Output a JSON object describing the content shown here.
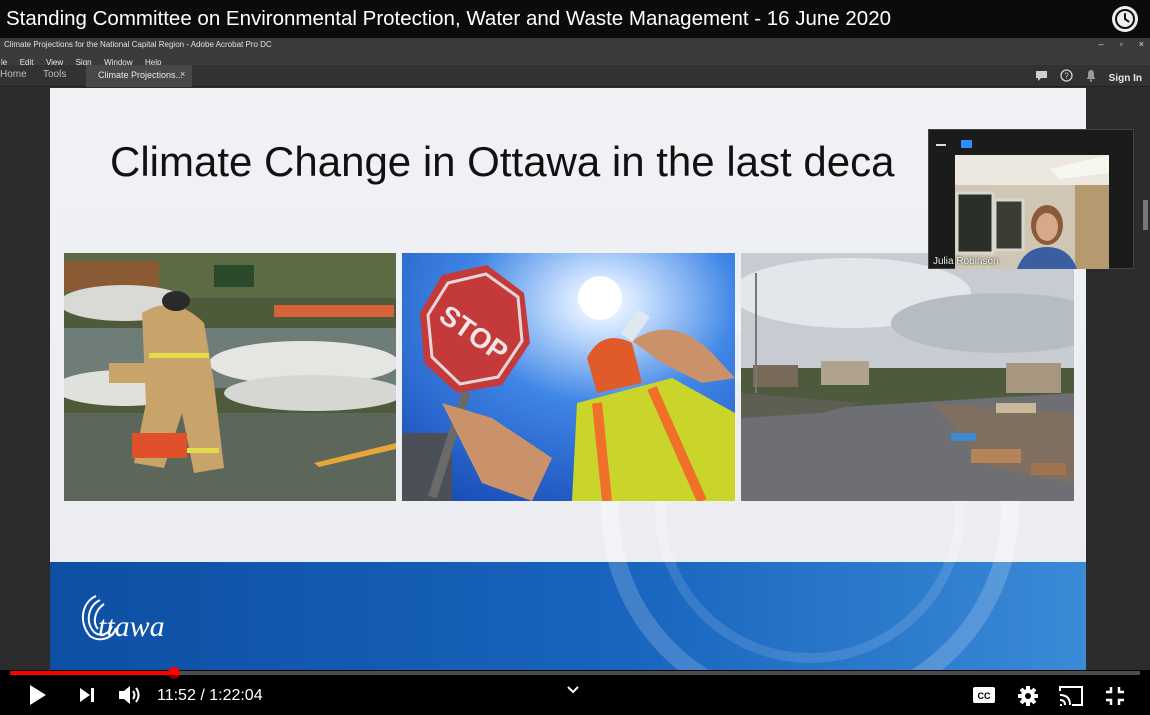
{
  "video": {
    "title": "Standing Committee on Environmental Protection, Water and Waste Management - 16 June 2020",
    "current_time": "11:52",
    "separator": "/",
    "duration": "1:22:04",
    "progress_fraction": 0.145,
    "icons": [
      "watch-later-icon",
      "play-icon",
      "next-icon",
      "volume-icon",
      "chevron-down-icon",
      "captions-icon",
      "settings-icon",
      "cast-icon",
      "exit-fullscreen-icon"
    ],
    "accent_color": "#ff0000"
  },
  "acrobat": {
    "window_title": "Climate Projections for the  National Capital Region - Adobe Acrobat Pro DC",
    "window_controls": [
      "–",
      "▫",
      "×"
    ],
    "menu": [
      "le",
      "Edit",
      "View",
      "Sign",
      "Window",
      "Help"
    ],
    "tabs": {
      "home": "Home",
      "tools": "Tools",
      "document": "Climate Projections...",
      "close": "×"
    },
    "sign_in": "Sign In",
    "icons": [
      "comment-icon",
      "help-icon",
      "bell-icon"
    ]
  },
  "slide": {
    "title": "Climate Change in Ottawa in the last deca",
    "photos": [
      "flood-sandbags-photo",
      "heat-stop-sign-photo",
      "tornado-debris-photo"
    ],
    "logo_text": "Ottawa",
    "footer_color": "#1864be"
  },
  "participant": {
    "name": "Julia Robinson"
  }
}
